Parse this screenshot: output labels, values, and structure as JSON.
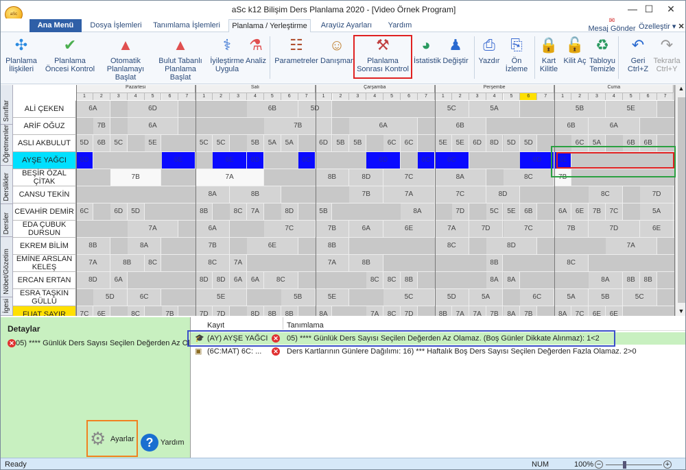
{
  "window": {
    "title": "aSc k12 Bilişim Ders Planlama 2020 - [Video Örnek Program]",
    "logo_text": "aSc",
    "controls": [
      "—",
      "☐",
      "✕"
    ]
  },
  "tabs": [
    {
      "label": "Ana Menü",
      "active": false,
      "home": true
    },
    {
      "label": "Dosya İşlemleri",
      "active": false
    },
    {
      "label": "Tanımlama İşlemleri",
      "active": false
    },
    {
      "label": "Planlama / Yerleştirme",
      "active": true
    },
    {
      "label": "Arayüz Ayarları",
      "active": false
    },
    {
      "label": "Yardım",
      "active": false
    }
  ],
  "header_right": {
    "mesaj": "Mesaj Gönder",
    "ozellestir": "Özelleştir ▾",
    "close": "✕"
  },
  "ribbon": [
    {
      "label": "Planlama İlişkileri",
      "icon": "network-icon",
      "glyph": "✣",
      "color": "#2a8ae0"
    },
    {
      "label": "Planlama Öncesi Kontrol",
      "icon": "check-icon",
      "glyph": "✔",
      "color": "#4caf50"
    },
    {
      "label": "Otomatik Planlamayı Başlat",
      "icon": "person-red-icon",
      "glyph": "▲",
      "color": "#e05050"
    },
    {
      "label": "Bulut Tabanlı Planlama Başlat",
      "icon": "cloud-person-icon",
      "glyph": "▲",
      "color": "#e05050"
    },
    {
      "label": "İyileştirme Uygula",
      "icon": "wand-icon",
      "glyph": "⚕",
      "color": "#2a6ad0"
    },
    {
      "label": "Analiz",
      "icon": "flask-icon",
      "glyph": "⚗",
      "color": "#e05050"
    },
    {
      "label": "Parametreler",
      "icon": "abacus-icon",
      "glyph": "☷",
      "color": "#b05030"
    },
    {
      "label": "Danışman",
      "icon": "advisor-icon",
      "glyph": "☺",
      "color": "#c08030"
    },
    {
      "label": "Planlama Sonrası Kontrol",
      "icon": "gavel-icon",
      "glyph": "⚒",
      "color": "#c04040"
    },
    {
      "label": "İstatistik",
      "icon": "pie-chart-icon",
      "glyph": "◕",
      "color": "#2a9a60"
    },
    {
      "label": "Değiştir",
      "icon": "swap-person-icon",
      "glyph": "♟",
      "color": "#2a6ad0"
    },
    {
      "label": "Yazdır",
      "icon": "printer-icon",
      "glyph": "⎙",
      "color": "#3a6ad0"
    },
    {
      "label": "Ön İzleme",
      "icon": "preview-icon",
      "glyph": "⎘",
      "color": "#3a6ad0"
    },
    {
      "label": "Kart Kilitle",
      "icon": "lock-icon",
      "glyph": "🔒",
      "color": "#2a6ad0"
    },
    {
      "label": "Kilit Aç",
      "icon": "unlock-icon",
      "glyph": "🔓",
      "color": "#2a9a60"
    },
    {
      "label": "Tabloyu Temizle",
      "icon": "recycle-icon",
      "glyph": "♻",
      "color": "#2a9a60"
    },
    {
      "label": "Geri Ctrl+Z",
      "icon": "undo-icon",
      "glyph": "↶",
      "color": "#2a6ad0"
    },
    {
      "label": "Tekrarla Ctrl+Y",
      "icon": "redo-icon",
      "glyph": "↷",
      "color": "#999999"
    }
  ],
  "side_tabs": [
    "Sınıflar",
    "Öğretmenler",
    "Derslikler",
    "Dersler",
    "Nöbet/Gözetim",
    "İgesi"
  ],
  "days": [
    "Pazartesi",
    "Salı",
    "Çarşamba",
    "Perşembe",
    "Cuma"
  ],
  "periods": [
    "1",
    "2",
    "3",
    "4",
    "5",
    "6",
    "7"
  ],
  "highlight_period": {
    "day": 3,
    "period": 5
  },
  "teachers": [
    {
      "name": "ALİ ÇEKEN",
      "cells": [
        [
          0,
          2,
          "6A"
        ],
        [
          3,
          3,
          "6D"
        ],
        [
          10,
          3,
          "6B"
        ],
        [
          13,
          2,
          "5D"
        ],
        [
          21,
          2,
          "5C"
        ],
        [
          23,
          3,
          "5A"
        ],
        [
          28,
          3,
          "5B"
        ],
        [
          31,
          3,
          "5E"
        ],
        [
          35,
          1,
          "6E"
        ],
        [
          38,
          4,
          "6C"
        ]
      ]
    },
    {
      "name": "ARİF OĞUZ",
      "cells": [
        [
          1,
          1,
          "7B"
        ],
        [
          3,
          3,
          "6A"
        ],
        [
          11,
          4,
          "7B"
        ],
        [
          16,
          4,
          "6A"
        ],
        [
          21,
          3,
          "6B"
        ],
        [
          28,
          2,
          "6B"
        ],
        [
          30,
          3,
          "6A"
        ],
        [
          35,
          2,
          "6B"
        ],
        [
          37,
          3,
          "7B"
        ]
      ]
    },
    {
      "name": "ASLI AKBULUT",
      "cells": [
        [
          0,
          1,
          "5D"
        ],
        [
          1,
          1,
          "6B"
        ],
        [
          2,
          1,
          "5C"
        ],
        [
          4,
          1,
          "5E"
        ],
        [
          7,
          1,
          "5C"
        ],
        [
          8,
          1,
          "5C"
        ],
        [
          10,
          1,
          "5B"
        ],
        [
          11,
          1,
          "5A"
        ],
        [
          12,
          1,
          "5A"
        ],
        [
          14,
          1,
          "6D"
        ],
        [
          15,
          1,
          "5B"
        ],
        [
          16,
          1,
          "5B"
        ],
        [
          18,
          1,
          "6C"
        ],
        [
          19,
          1,
          "6C"
        ],
        [
          21,
          1,
          "5E"
        ],
        [
          22,
          1,
          "5E"
        ],
        [
          23,
          1,
          "6D"
        ],
        [
          24,
          1,
          "8D"
        ],
        [
          25,
          1,
          "5D"
        ],
        [
          26,
          1,
          "5D"
        ],
        [
          29,
          1,
          "6C"
        ],
        [
          30,
          1,
          "5A"
        ],
        [
          32,
          1,
          "6B"
        ],
        [
          33,
          1,
          "6B"
        ]
      ]
    },
    {
      "name": "AYŞE YAĞCI",
      "sel": true,
      "cells": [
        [
          0,
          1,
          "6D",
          "blue"
        ],
        [
          5,
          2,
          "6E",
          "blue"
        ],
        [
          8,
          2,
          "6E",
          "blue"
        ],
        [
          10,
          1,
          "6D",
          "blue"
        ],
        [
          13,
          1,
          "6C",
          "blue"
        ],
        [
          17,
          2,
          "6D",
          "blue"
        ],
        [
          20,
          1,
          "6C",
          "blue"
        ],
        [
          21,
          2,
          "6C",
          "blue"
        ],
        [
          26,
          2,
          "6D",
          "blue"
        ],
        [
          28,
          1,
          "6E",
          "blue"
        ]
      ]
    },
    {
      "name": "BEŞİR ÖZAL ÇİTAK",
      "cells": [
        [
          2,
          3,
          "7B",
          "white"
        ],
        [
          7,
          4,
          "7A",
          "white"
        ],
        [
          14,
          2,
          "8B"
        ],
        [
          16,
          2,
          "8D"
        ],
        [
          18,
          3,
          "7C"
        ],
        [
          21,
          3,
          "8A"
        ],
        [
          25,
          3,
          "8C"
        ],
        [
          28,
          1,
          "7B",
          "white"
        ]
      ]
    },
    {
      "name": "CANSU TEKİN",
      "cells": [
        [
          7,
          2,
          "8A"
        ],
        [
          9,
          3,
          "8B"
        ],
        [
          16,
          2,
          "7B"
        ],
        [
          18,
          3,
          "7A"
        ],
        [
          21,
          3,
          "7C"
        ],
        [
          24,
          2,
          "8D"
        ],
        [
          30,
          2,
          "8C"
        ],
        [
          33,
          2,
          "7D"
        ]
      ]
    },
    {
      "name": "CEVAHİR DEMİR",
      "cells": [
        [
          0,
          1,
          "6C"
        ],
        [
          2,
          1,
          "6D"
        ],
        [
          3,
          1,
          "5D"
        ],
        [
          7,
          1,
          "8B"
        ],
        [
          9,
          1,
          "8C"
        ],
        [
          10,
          1,
          "7A"
        ],
        [
          12,
          1,
          "8D"
        ],
        [
          14,
          1,
          "5B"
        ],
        [
          19,
          2,
          "8A"
        ],
        [
          22,
          1,
          "7D"
        ],
        [
          24,
          1,
          "5C"
        ],
        [
          25,
          1,
          "5E"
        ],
        [
          26,
          1,
          "6B"
        ],
        [
          28,
          1,
          "6A"
        ],
        [
          29,
          1,
          "6E"
        ],
        [
          30,
          1,
          "7B"
        ],
        [
          31,
          1,
          "7C"
        ],
        [
          33,
          2,
          "5A"
        ]
      ]
    },
    {
      "name": "EDA ÇUBUK DURSUN",
      "cells": [
        [
          3,
          3,
          "7A"
        ],
        [
          7,
          2,
          "6A"
        ],
        [
          11,
          3,
          "7C"
        ],
        [
          14,
          2,
          "7B"
        ],
        [
          16,
          2,
          "6A"
        ],
        [
          18,
          3,
          "6E"
        ],
        [
          21,
          2,
          "7A"
        ],
        [
          23,
          2,
          "7D"
        ],
        [
          25,
          3,
          "7C"
        ],
        [
          28,
          2,
          "7B"
        ],
        [
          30,
          3,
          "7D"
        ],
        [
          33,
          2,
          "6E"
        ]
      ]
    },
    {
      "name": "EKREM BİLİM",
      "cells": [
        [
          0,
          2,
          "8B"
        ],
        [
          3,
          2,
          "8A"
        ],
        [
          7,
          2,
          "7B"
        ],
        [
          10,
          3,
          "6E"
        ],
        [
          14,
          2,
          "8B"
        ],
        [
          21,
          2,
          "8C"
        ],
        [
          24,
          3,
          "8D"
        ],
        [
          31,
          3,
          "7A"
        ]
      ]
    },
    {
      "name": "EMİNE ARSLAN KELEŞ",
      "cells": [
        [
          0,
          2,
          "7A"
        ],
        [
          2,
          2,
          "8B"
        ],
        [
          4,
          1,
          "8C"
        ],
        [
          7,
          2,
          "8C"
        ],
        [
          9,
          1,
          "7A"
        ],
        [
          14,
          2,
          "7A"
        ],
        [
          16,
          2,
          "8B"
        ],
        [
          24,
          1,
          "8B"
        ],
        [
          28,
          2,
          "8C"
        ]
      ]
    },
    {
      "name": "ERCAN ERTAN",
      "cells": [
        [
          0,
          2,
          "8D"
        ],
        [
          2,
          1,
          "6A"
        ],
        [
          7,
          1,
          "8D"
        ],
        [
          8,
          1,
          "8D"
        ],
        [
          9,
          1,
          "6A"
        ],
        [
          10,
          1,
          "6A"
        ],
        [
          11,
          2,
          "8C"
        ],
        [
          17,
          1,
          "8C"
        ],
        [
          18,
          1,
          "8C"
        ],
        [
          19,
          1,
          "8B"
        ],
        [
          24,
          1,
          "8A"
        ],
        [
          25,
          1,
          "8A"
        ],
        [
          30,
          2,
          "8A"
        ],
        [
          32,
          1,
          "8B"
        ],
        [
          33,
          1,
          "8B"
        ]
      ]
    },
    {
      "name": "ESRA TAŞKIN GÜLLÜ",
      "cells": [
        [
          1,
          2,
          "5D"
        ],
        [
          3,
          2,
          "6C"
        ],
        [
          7,
          3,
          "5E"
        ],
        [
          12,
          2,
          "5B"
        ],
        [
          14,
          2,
          "5E"
        ],
        [
          18,
          3,
          "5C"
        ],
        [
          21,
          2,
          "5D"
        ],
        [
          23,
          2,
          "5A"
        ],
        [
          26,
          2,
          "6C"
        ],
        [
          28,
          2,
          "5A"
        ],
        [
          30,
          2,
          "5B"
        ],
        [
          32,
          2,
          "5C"
        ]
      ]
    },
    {
      "name": "FUAT SAYIR",
      "yel": true,
      "cells": [
        [
          0,
          1,
          "7C"
        ],
        [
          1,
          1,
          "6E"
        ],
        [
          3,
          1,
          "8C"
        ],
        [
          5,
          1,
          "7B"
        ],
        [
          7,
          1,
          "7D"
        ],
        [
          8,
          1,
          "7D"
        ],
        [
          10,
          1,
          "8D"
        ],
        [
          11,
          1,
          "8B"
        ],
        [
          12,
          1,
          "8B"
        ],
        [
          14,
          1,
          "8A"
        ],
        [
          17,
          1,
          "7A"
        ],
        [
          18,
          1,
          "8C"
        ],
        [
          19,
          1,
          "7D"
        ],
        [
          21,
          1,
          "8B"
        ],
        [
          22,
          1,
          "7A"
        ],
        [
          23,
          1,
          "7A"
        ],
        [
          24,
          1,
          "7B"
        ],
        [
          25,
          1,
          "8A"
        ],
        [
          26,
          1,
          "7B"
        ],
        [
          28,
          1,
          "8A"
        ],
        [
          29,
          1,
          "7C"
        ],
        [
          30,
          1,
          "6E"
        ],
        [
          31,
          1,
          "6E"
        ]
      ]
    }
  ],
  "details": {
    "title": "Detaylar",
    "text": "05) **** Günlük Ders Sayısı Seçilen Değerden Az Olamaz",
    "settings": "Ayarlar",
    "help": "Yardım"
  },
  "list": {
    "col_kayit": "Kayıt",
    "col_tanim": "Tanımlama",
    "rows": [
      {
        "kayit": "(AY) AYŞE YAĞCI",
        "tanim": "05) **** Günlük Ders Sayısı Seçilen Değerden Az Olamaz. (Boş Günler Dikkate Alınmaz): 1<2",
        "icon": "teacher-icon",
        "sel": true
      },
      {
        "kayit": "(6C:MAT) 6C: ...",
        "tanim": "Ders Kartlarının Günlere Dağılımı: 16) *** Haftalık Boş Ders Sayısı Seçilen Değerden Fazla Olamaz. 2>0",
        "icon": "card-icon",
        "sel": false
      }
    ]
  },
  "status": {
    "left": "Ready",
    "num": "NUM",
    "zoom": "100%",
    "zoom_level": 1.0
  }
}
